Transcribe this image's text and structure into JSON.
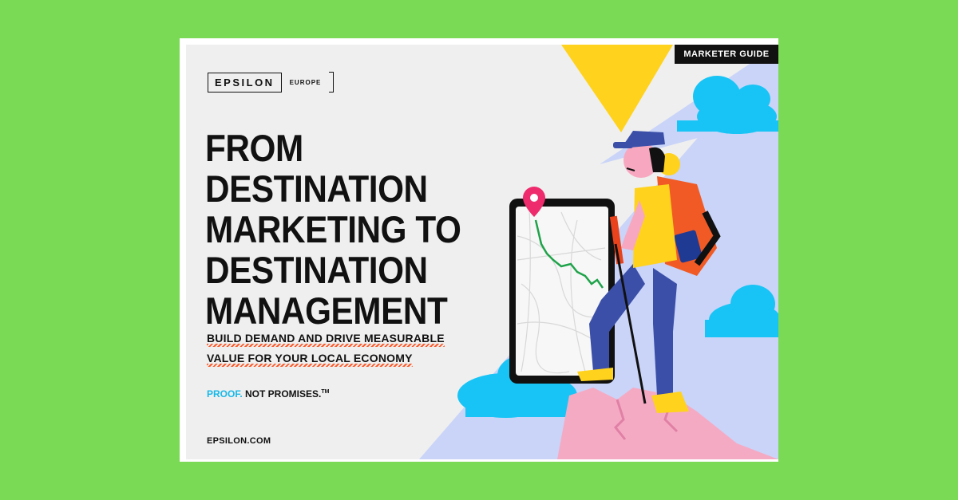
{
  "colors": {
    "page_background": "#7ad955",
    "paper": "#efefef",
    "accent_blue": "#18b8e8",
    "accent_orange": "#ff5a2a",
    "triangle_yellow": "#ffd21e",
    "sky_lavender": "#c9d4f8",
    "cloud_blue": "#18c4f5",
    "rock_pink": "#f5aac4"
  },
  "badge": "MARKETER GUIDE",
  "logo": {
    "brand": "EPSILON",
    "region": "EUROPE"
  },
  "headline": [
    "FROM DESTINATION",
    "MARKETING TO",
    "DESTINATION",
    "MANAGEMENT"
  ],
  "subhead": [
    "BUILD DEMAND AND DRIVE MEASURABLE",
    "VALUE FOR YOUR LOCAL ECONOMY"
  ],
  "tagline": {
    "proof": "PROOF.",
    "rest": "NOT PROMISES.",
    "mark": "TM"
  },
  "url": "EPSILON.COM",
  "illustration_icons": [
    "location-pin-icon",
    "phone-map-icon",
    "hiker-icon",
    "cloud-icon"
  ]
}
